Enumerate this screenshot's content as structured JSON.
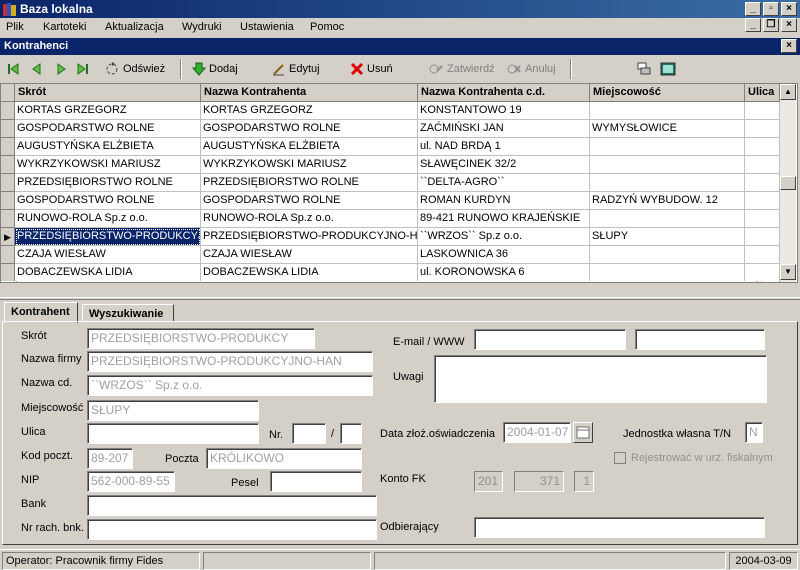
{
  "window": {
    "title": "Baza lokalna"
  },
  "menu": [
    "Plik",
    "Kartoteki",
    "Aktualizacja",
    "Wydruki",
    "Ustawienia",
    "Pomoc"
  ],
  "child": {
    "title": "Kontrahenci"
  },
  "toolbar": {
    "refresh": "Odśwież",
    "add": "Dodaj",
    "edit": "Edytuj",
    "delete": "Usuń",
    "confirm": "Zatwierdź",
    "cancel": "Anuluj"
  },
  "grid": {
    "columns": [
      "Skrót",
      "Nazwa Kontrahenta",
      "Nazwa Kontrahenta c.d.",
      "Miejscowość",
      "Ulica"
    ],
    "rows": [
      [
        "KORTAS GRZEGORZ",
        "KORTAS GRZEGORZ",
        "KONSTANTOWO 19",
        "",
        ""
      ],
      [
        "GOSPODARSTWO ROLNE",
        "GOSPODARSTWO ROLNE",
        "ZAĆMIŃSKI JAN",
        "WYMYSŁOWICE",
        ""
      ],
      [
        "AUGUSTYŃSKA ELŻBIETA",
        "AUGUSTYŃSKA ELŻBIETA",
        "ul. NAD BRDĄ 1",
        "",
        ""
      ],
      [
        "WYKRZYKOWSKI MARIUSZ",
        "WYKRZYKOWSKI MARIUSZ",
        "SŁAWĘCINEK 32/2",
        "",
        ""
      ],
      [
        "PRZEDSIĘBIORSTWO ROLNE",
        "PRZEDSIĘBIORSTWO ROLNE",
        "``DELTA-AGRO``",
        "",
        ""
      ],
      [
        "GOSPODARSTWO ROLNE",
        "GOSPODARSTWO ROLNE",
        "ROMAN KURDYN",
        "RADZYŃ WYBUDOW. 12",
        ""
      ],
      [
        "RUNOWO-ROLA Sp.z o.o.",
        "RUNOWO-ROLA Sp.z o.o.",
        "89-421 RUNOWO KRAJEŃSKIE",
        "",
        ""
      ],
      [
        "PRZEDSIĘBIORSTWO-PRODUKCYJ",
        "PRZEDSIĘBIORSTWO-PRODUKCYJNO-HA",
        "``WRZOS`` Sp.z o.o.",
        "SŁUPY",
        ""
      ],
      [
        "CZAJA WIESŁAW",
        "CZAJA WIESŁAW",
        "LASKOWNICA 36",
        "",
        ""
      ],
      [
        "DOBACZEWSKA LIDIA",
        "DOBACZEWSKA LIDIA",
        "ul. KORONOWSKA 6",
        "",
        ""
      ]
    ],
    "selected_row": 7
  },
  "tabs": [
    "Kontrahent",
    "Wyszukiwanie"
  ],
  "form": {
    "labels": {
      "skrot": "Skrót",
      "nazwa": "Nazwa firmy",
      "nazwa_cd": "Nazwa cd.",
      "miejscowosc": "Miejscowość",
      "ulica": "Ulica",
      "nr": "Nr.",
      "slash": "/",
      "kod": "Kod poczt.",
      "poczta": "Poczta",
      "nip": "NIP",
      "pesel": "Pesel",
      "bank": "Bank",
      "nr_rach": "Nr rach. bnk.",
      "email": "E-mail / WWW",
      "uwagi": "Uwagi",
      "data_osw": "Data złoż.oświadczenia",
      "jednostka": "Jednostka własna T/N",
      "rejestrowac": "Rejestrować w urz. fiskalnym",
      "konto": "Konto FK",
      "odbierajacy": "Odbierający"
    },
    "values": {
      "skrot": "PRZEDSIĘBIORSTWO-PRODUKCY",
      "nazwa": "PRZEDSIĘBIORSTWO-PRODUKCYJNO-HAN",
      "nazwa_cd": "``WRZOS`` Sp.z o.o.",
      "miejscowosc": "SŁUPY",
      "ulica": "",
      "nr1": "",
      "nr2": "",
      "kod": "89-207",
      "poczta": "KRÓLIKOWO",
      "nip": "562-000-89-55",
      "pesel": "",
      "bank": "",
      "nr_rach": "",
      "email1": "",
      "email2": "",
      "uwagi": "",
      "data_osw": "2004-01-07",
      "jednostka": "N",
      "konto1": "201",
      "konto2": "371",
      "konto3": "1",
      "odbierajacy": ""
    }
  },
  "status": {
    "operator": "Operator: Pracownik firmy Fides",
    "date": "2004-03-09"
  }
}
